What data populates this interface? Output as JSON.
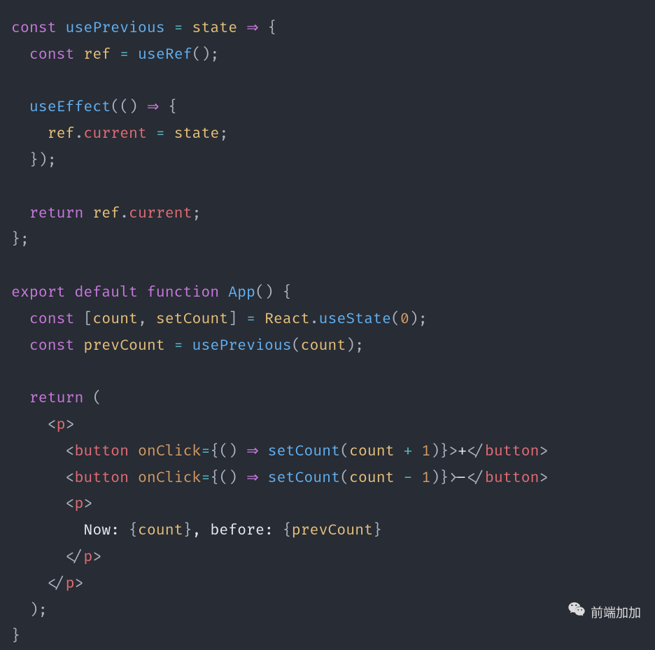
{
  "code": {
    "tokens": [
      [
        {
          "t": "const ",
          "c": "kw"
        },
        {
          "t": "usePrevious",
          "c": "fn"
        },
        {
          "t": " ",
          "c": "pun"
        },
        {
          "t": "=",
          "c": "op"
        },
        {
          "t": " ",
          "c": "pun"
        },
        {
          "t": "state",
          "c": "id"
        },
        {
          "t": " ",
          "c": "pun"
        },
        {
          "t": "⇒",
          "c": "kw"
        },
        {
          "t": " {",
          "c": "pun"
        }
      ],
      [
        {
          "t": "  ",
          "c": "pun"
        },
        {
          "t": "const ",
          "c": "kw"
        },
        {
          "t": "ref",
          "c": "id"
        },
        {
          "t": " ",
          "c": "pun"
        },
        {
          "t": "=",
          "c": "op"
        },
        {
          "t": " ",
          "c": "pun"
        },
        {
          "t": "useRef",
          "c": "fn"
        },
        {
          "t": "();",
          "c": "pun"
        }
      ],
      [
        {
          "t": " ",
          "c": "pun"
        }
      ],
      [
        {
          "t": "  ",
          "c": "pun"
        },
        {
          "t": "useEffect",
          "c": "fn"
        },
        {
          "t": "(() ",
          "c": "pun"
        },
        {
          "t": "⇒",
          "c": "kw"
        },
        {
          "t": " {",
          "c": "pun"
        }
      ],
      [
        {
          "t": "    ",
          "c": "pun"
        },
        {
          "t": "ref",
          "c": "id"
        },
        {
          "t": ".",
          "c": "pun"
        },
        {
          "t": "current",
          "c": "prop"
        },
        {
          "t": " ",
          "c": "pun"
        },
        {
          "t": "=",
          "c": "op"
        },
        {
          "t": " ",
          "c": "pun"
        },
        {
          "t": "state",
          "c": "id"
        },
        {
          "t": ";",
          "c": "pun"
        }
      ],
      [
        {
          "t": "  });",
          "c": "pun"
        }
      ],
      [
        {
          "t": " ",
          "c": "pun"
        }
      ],
      [
        {
          "t": "  ",
          "c": "pun"
        },
        {
          "t": "return ",
          "c": "kw"
        },
        {
          "t": "ref",
          "c": "id"
        },
        {
          "t": ".",
          "c": "pun"
        },
        {
          "t": "current",
          "c": "prop"
        },
        {
          "t": ";",
          "c": "pun"
        }
      ],
      [
        {
          "t": "};",
          "c": "pun"
        }
      ],
      [
        {
          "t": " ",
          "c": "pun"
        }
      ],
      [
        {
          "t": "export default function ",
          "c": "kw"
        },
        {
          "t": "App",
          "c": "fn"
        },
        {
          "t": "() {",
          "c": "pun"
        }
      ],
      [
        {
          "t": "  ",
          "c": "pun"
        },
        {
          "t": "const ",
          "c": "kw"
        },
        {
          "t": "[",
          "c": "pun"
        },
        {
          "t": "count",
          "c": "id"
        },
        {
          "t": ", ",
          "c": "pun"
        },
        {
          "t": "setCount",
          "c": "id"
        },
        {
          "t": "] ",
          "c": "pun"
        },
        {
          "t": "=",
          "c": "op"
        },
        {
          "t": " ",
          "c": "pun"
        },
        {
          "t": "React",
          "c": "id"
        },
        {
          "t": ".",
          "c": "pun"
        },
        {
          "t": "useState",
          "c": "fn"
        },
        {
          "t": "(",
          "c": "pun"
        },
        {
          "t": "0",
          "c": "num"
        },
        {
          "t": ");",
          "c": "pun"
        }
      ],
      [
        {
          "t": "  ",
          "c": "pun"
        },
        {
          "t": "const ",
          "c": "kw"
        },
        {
          "t": "prevCount",
          "c": "id"
        },
        {
          "t": " ",
          "c": "pun"
        },
        {
          "t": "=",
          "c": "op"
        },
        {
          "t": " ",
          "c": "pun"
        },
        {
          "t": "usePrevious",
          "c": "fn"
        },
        {
          "t": "(",
          "c": "pun"
        },
        {
          "t": "count",
          "c": "id"
        },
        {
          "t": ");",
          "c": "pun"
        }
      ],
      [
        {
          "t": " ",
          "c": "pun"
        }
      ],
      [
        {
          "t": "  ",
          "c": "pun"
        },
        {
          "t": "return",
          "c": "kw"
        },
        {
          "t": " (",
          "c": "pun"
        }
      ],
      [
        {
          "t": "    ",
          "c": "pun"
        },
        {
          "t": "<",
          "c": "pun"
        },
        {
          "t": "p",
          "c": "prop"
        },
        {
          "t": ">",
          "c": "pun"
        }
      ],
      [
        {
          "t": "      ",
          "c": "pun"
        },
        {
          "t": "<",
          "c": "pun"
        },
        {
          "t": "button",
          "c": "prop"
        },
        {
          "t": " ",
          "c": "pun"
        },
        {
          "t": "onClick",
          "c": "attr"
        },
        {
          "t": "=",
          "c": "op"
        },
        {
          "t": "{() ",
          "c": "pun"
        },
        {
          "t": "⇒",
          "c": "kw"
        },
        {
          "t": " ",
          "c": "pun"
        },
        {
          "t": "setCount",
          "c": "fn"
        },
        {
          "t": "(",
          "c": "pun"
        },
        {
          "t": "count",
          "c": "id"
        },
        {
          "t": " ",
          "c": "pun"
        },
        {
          "t": "+",
          "c": "op"
        },
        {
          "t": " ",
          "c": "pun"
        },
        {
          "t": "1",
          "c": "num"
        },
        {
          "t": ")}",
          "c": "pun"
        },
        {
          "t": ">",
          "c": "pun"
        },
        {
          "t": "+",
          "c": "plain"
        },
        {
          "t": "</",
          "c": "pun"
        },
        {
          "t": "button",
          "c": "prop"
        },
        {
          "t": ">",
          "c": "pun"
        }
      ],
      [
        {
          "t": "      ",
          "c": "pun"
        },
        {
          "t": "<",
          "c": "pun"
        },
        {
          "t": "button",
          "c": "prop"
        },
        {
          "t": " ",
          "c": "pun"
        },
        {
          "t": "onClick",
          "c": "attr"
        },
        {
          "t": "=",
          "c": "op"
        },
        {
          "t": "{() ",
          "c": "pun"
        },
        {
          "t": "⇒",
          "c": "kw"
        },
        {
          "t": " ",
          "c": "pun"
        },
        {
          "t": "setCount",
          "c": "fn"
        },
        {
          "t": "(",
          "c": "pun"
        },
        {
          "t": "count",
          "c": "id"
        },
        {
          "t": " ",
          "c": "pun"
        },
        {
          "t": "-",
          "c": "op"
        },
        {
          "t": " ",
          "c": "pun"
        },
        {
          "t": "1",
          "c": "num"
        },
        {
          "t": ")}",
          "c": "pun"
        },
        {
          "t": ">",
          "c": "pun"
        },
        {
          "t": "-",
          "c": "plain"
        },
        {
          "t": "</",
          "c": "pun"
        },
        {
          "t": "button",
          "c": "prop"
        },
        {
          "t": ">",
          "c": "pun"
        }
      ],
      [
        {
          "t": "      ",
          "c": "pun"
        },
        {
          "t": "<",
          "c": "pun"
        },
        {
          "t": "p",
          "c": "prop"
        },
        {
          "t": ">",
          "c": "pun"
        }
      ],
      [
        {
          "t": "        ",
          "c": "pun"
        },
        {
          "t": "Now: ",
          "c": "plain"
        },
        {
          "t": "{",
          "c": "pun"
        },
        {
          "t": "count",
          "c": "id"
        },
        {
          "t": "}",
          "c": "pun"
        },
        {
          "t": ", before: ",
          "c": "plain"
        },
        {
          "t": "{",
          "c": "pun"
        },
        {
          "t": "prevCount",
          "c": "id"
        },
        {
          "t": "}",
          "c": "pun"
        }
      ],
      [
        {
          "t": "      ",
          "c": "pun"
        },
        {
          "t": "</",
          "c": "pun"
        },
        {
          "t": "p",
          "c": "prop"
        },
        {
          "t": ">",
          "c": "pun"
        }
      ],
      [
        {
          "t": "    ",
          "c": "pun"
        },
        {
          "t": "</",
          "c": "pun"
        },
        {
          "t": "p",
          "c": "prop"
        },
        {
          "t": ">",
          "c": "pun"
        }
      ],
      [
        {
          "t": "  );",
          "c": "pun"
        }
      ],
      [
        {
          "t": "}",
          "c": "pun"
        }
      ]
    ]
  },
  "watermark": {
    "icon": "wechat-icon",
    "text": "前端加加"
  }
}
